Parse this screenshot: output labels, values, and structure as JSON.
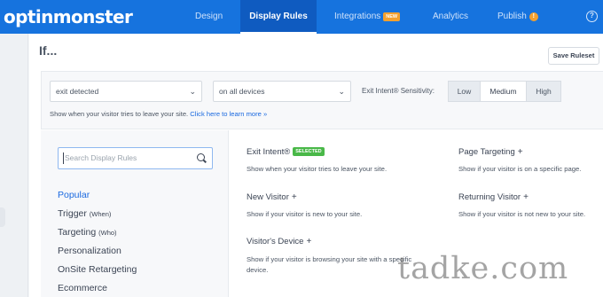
{
  "brand": {
    "logo_text": "optinmonster"
  },
  "nav": {
    "items": [
      {
        "label": "Design"
      },
      {
        "label": "Display Rules"
      },
      {
        "label": "Integrations",
        "badge": "NEW"
      },
      {
        "label": "Analytics"
      },
      {
        "label": "Publish",
        "badge": "!"
      }
    ],
    "help": "?"
  },
  "page": {
    "title": "If...",
    "save_label": "Save Ruleset"
  },
  "rule": {
    "condition": "exit detected",
    "devices": "on all devices",
    "sensitivity_label": "Exit Intent® Sensitivity:",
    "sensitivity_options": [
      "Low",
      "Medium",
      "High"
    ],
    "sensitivity_selected": "Medium",
    "hint": "Show when your visitor tries to leave your site.",
    "hint_link": "Click here to learn more »"
  },
  "search": {
    "placeholder": "Search Display Rules"
  },
  "categories": [
    {
      "label": "Popular",
      "sub": ""
    },
    {
      "label": "Trigger",
      "sub": "(When)"
    },
    {
      "label": "Targeting",
      "sub": "(Who)"
    },
    {
      "label": "Personalization",
      "sub": ""
    },
    {
      "label": "OnSite Retargeting",
      "sub": ""
    },
    {
      "label": "Ecommerce",
      "sub": ""
    }
  ],
  "rules": {
    "exit_intent": {
      "title": "Exit Intent®",
      "badge": "SELECTED",
      "desc": "Show when your visitor tries to leave your site."
    },
    "page_targeting": {
      "title": "Page Targeting",
      "plus": "+",
      "desc": "Show if your visitor is on a specific page."
    },
    "new_visitor": {
      "title": "New Visitor",
      "plus": "+",
      "desc": "Show if your visitor is new to your site."
    },
    "returning_visitor": {
      "title": "Returning Visitor",
      "plus": "+",
      "desc": "Show if your visitor is not new to your site."
    },
    "visitors_device": {
      "title": "Visitor's Device",
      "plus": "+",
      "desc_line1": "Show if your visitor is browsing your site with a specific",
      "desc_line2": "device."
    }
  },
  "watermark": "tadke.com",
  "colors": {
    "nav_bg": "#1673de",
    "accent": "#1b6ae0",
    "selected_badge": "#49b848",
    "new_badge": "#f3a02e"
  }
}
